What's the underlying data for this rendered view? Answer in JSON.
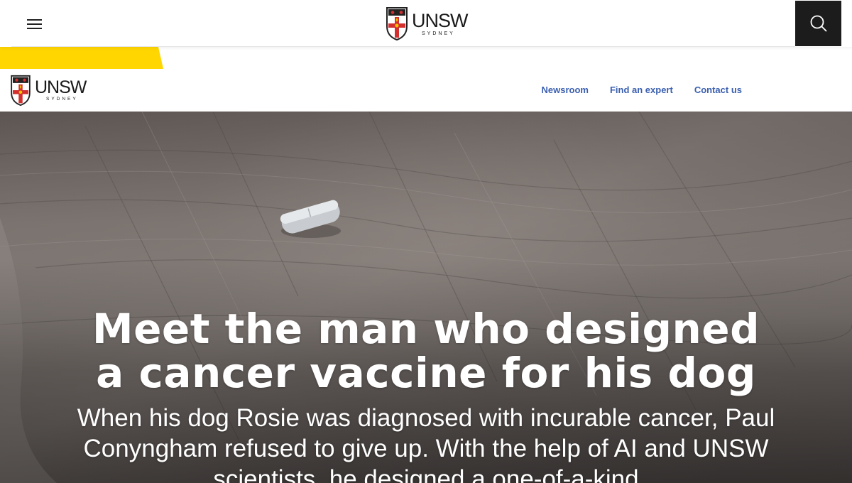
{
  "header": {
    "menu_icon": "hamburger-menu-icon",
    "search_icon": "search-icon",
    "logo": {
      "wordmark": "UNSW",
      "location": "SYDNEY"
    }
  },
  "subnav": {
    "logo": {
      "wordmark": "UNSW",
      "location": "SYDNEY"
    },
    "links": [
      {
        "label": "Newsroom"
      },
      {
        "label": "Find an expert"
      },
      {
        "label": "Contact us"
      }
    ]
  },
  "hero": {
    "title": "Meet the man who designed a cancer vaccine for his dog",
    "description": "When his dog Rosie was diagnosed with incurable cancer, Paul Conyngham refused to give up. With the help of AI and UNSW scientists, he designed a one-of-a-kind"
  },
  "colors": {
    "accent_yellow": "#ffd600",
    "link_blue": "#3a5faf",
    "search_bg": "#1c1c1c",
    "crest_red": "#d32f2f"
  }
}
